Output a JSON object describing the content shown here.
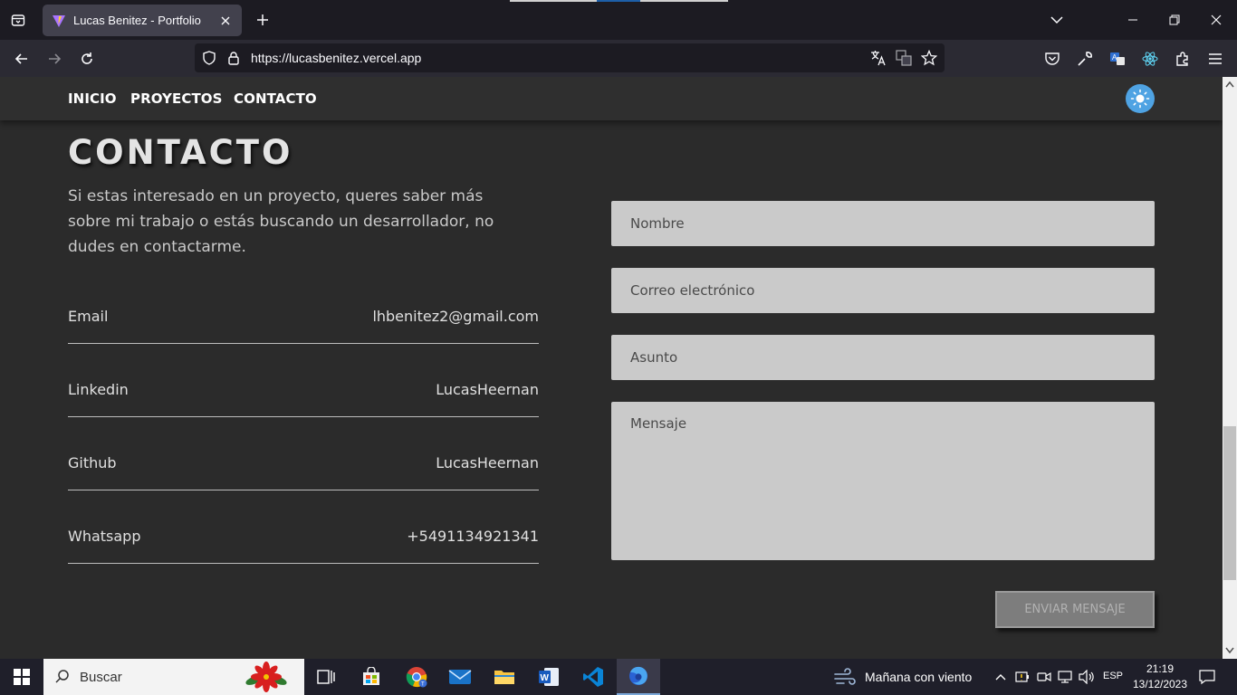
{
  "browser": {
    "tab_title": "Lucas Benitez - Portfolio",
    "url": "https://lucasbenitez.vercel.app"
  },
  "site": {
    "nav": [
      "INICIO",
      "PROYECTOS",
      "CONTACTO"
    ],
    "heading": "CONTACTO",
    "intro": "Si estas interesado en un proyecto, queres saber más sobre mi trabajo o estás buscando un desarrollador, no dudes en contactarme.",
    "contacts": [
      {
        "label": "Email",
        "value": "lhbenitez2@gmail.com"
      },
      {
        "label": "Linkedin",
        "value": "LucasHeernan"
      },
      {
        "label": "Github",
        "value": "LucasHeernan"
      },
      {
        "label": "Whatsapp",
        "value": "+5491134921341"
      }
    ],
    "form": {
      "name_placeholder": "Nombre",
      "email_placeholder": "Correo electrónico",
      "subject_placeholder": "Asunto",
      "message_placeholder": "Mensaje",
      "submit_label": "ENVIAR MENSAJE"
    }
  },
  "taskbar": {
    "search_label": "Buscar",
    "weather": "Mañana con viento",
    "language": "ESP",
    "time": "21:19",
    "date": "13/12/2023"
  },
  "colors": {
    "page_bg": "#2b2b2b",
    "field_bg": "#cacaca",
    "theme_button": "#4fa3e3"
  }
}
